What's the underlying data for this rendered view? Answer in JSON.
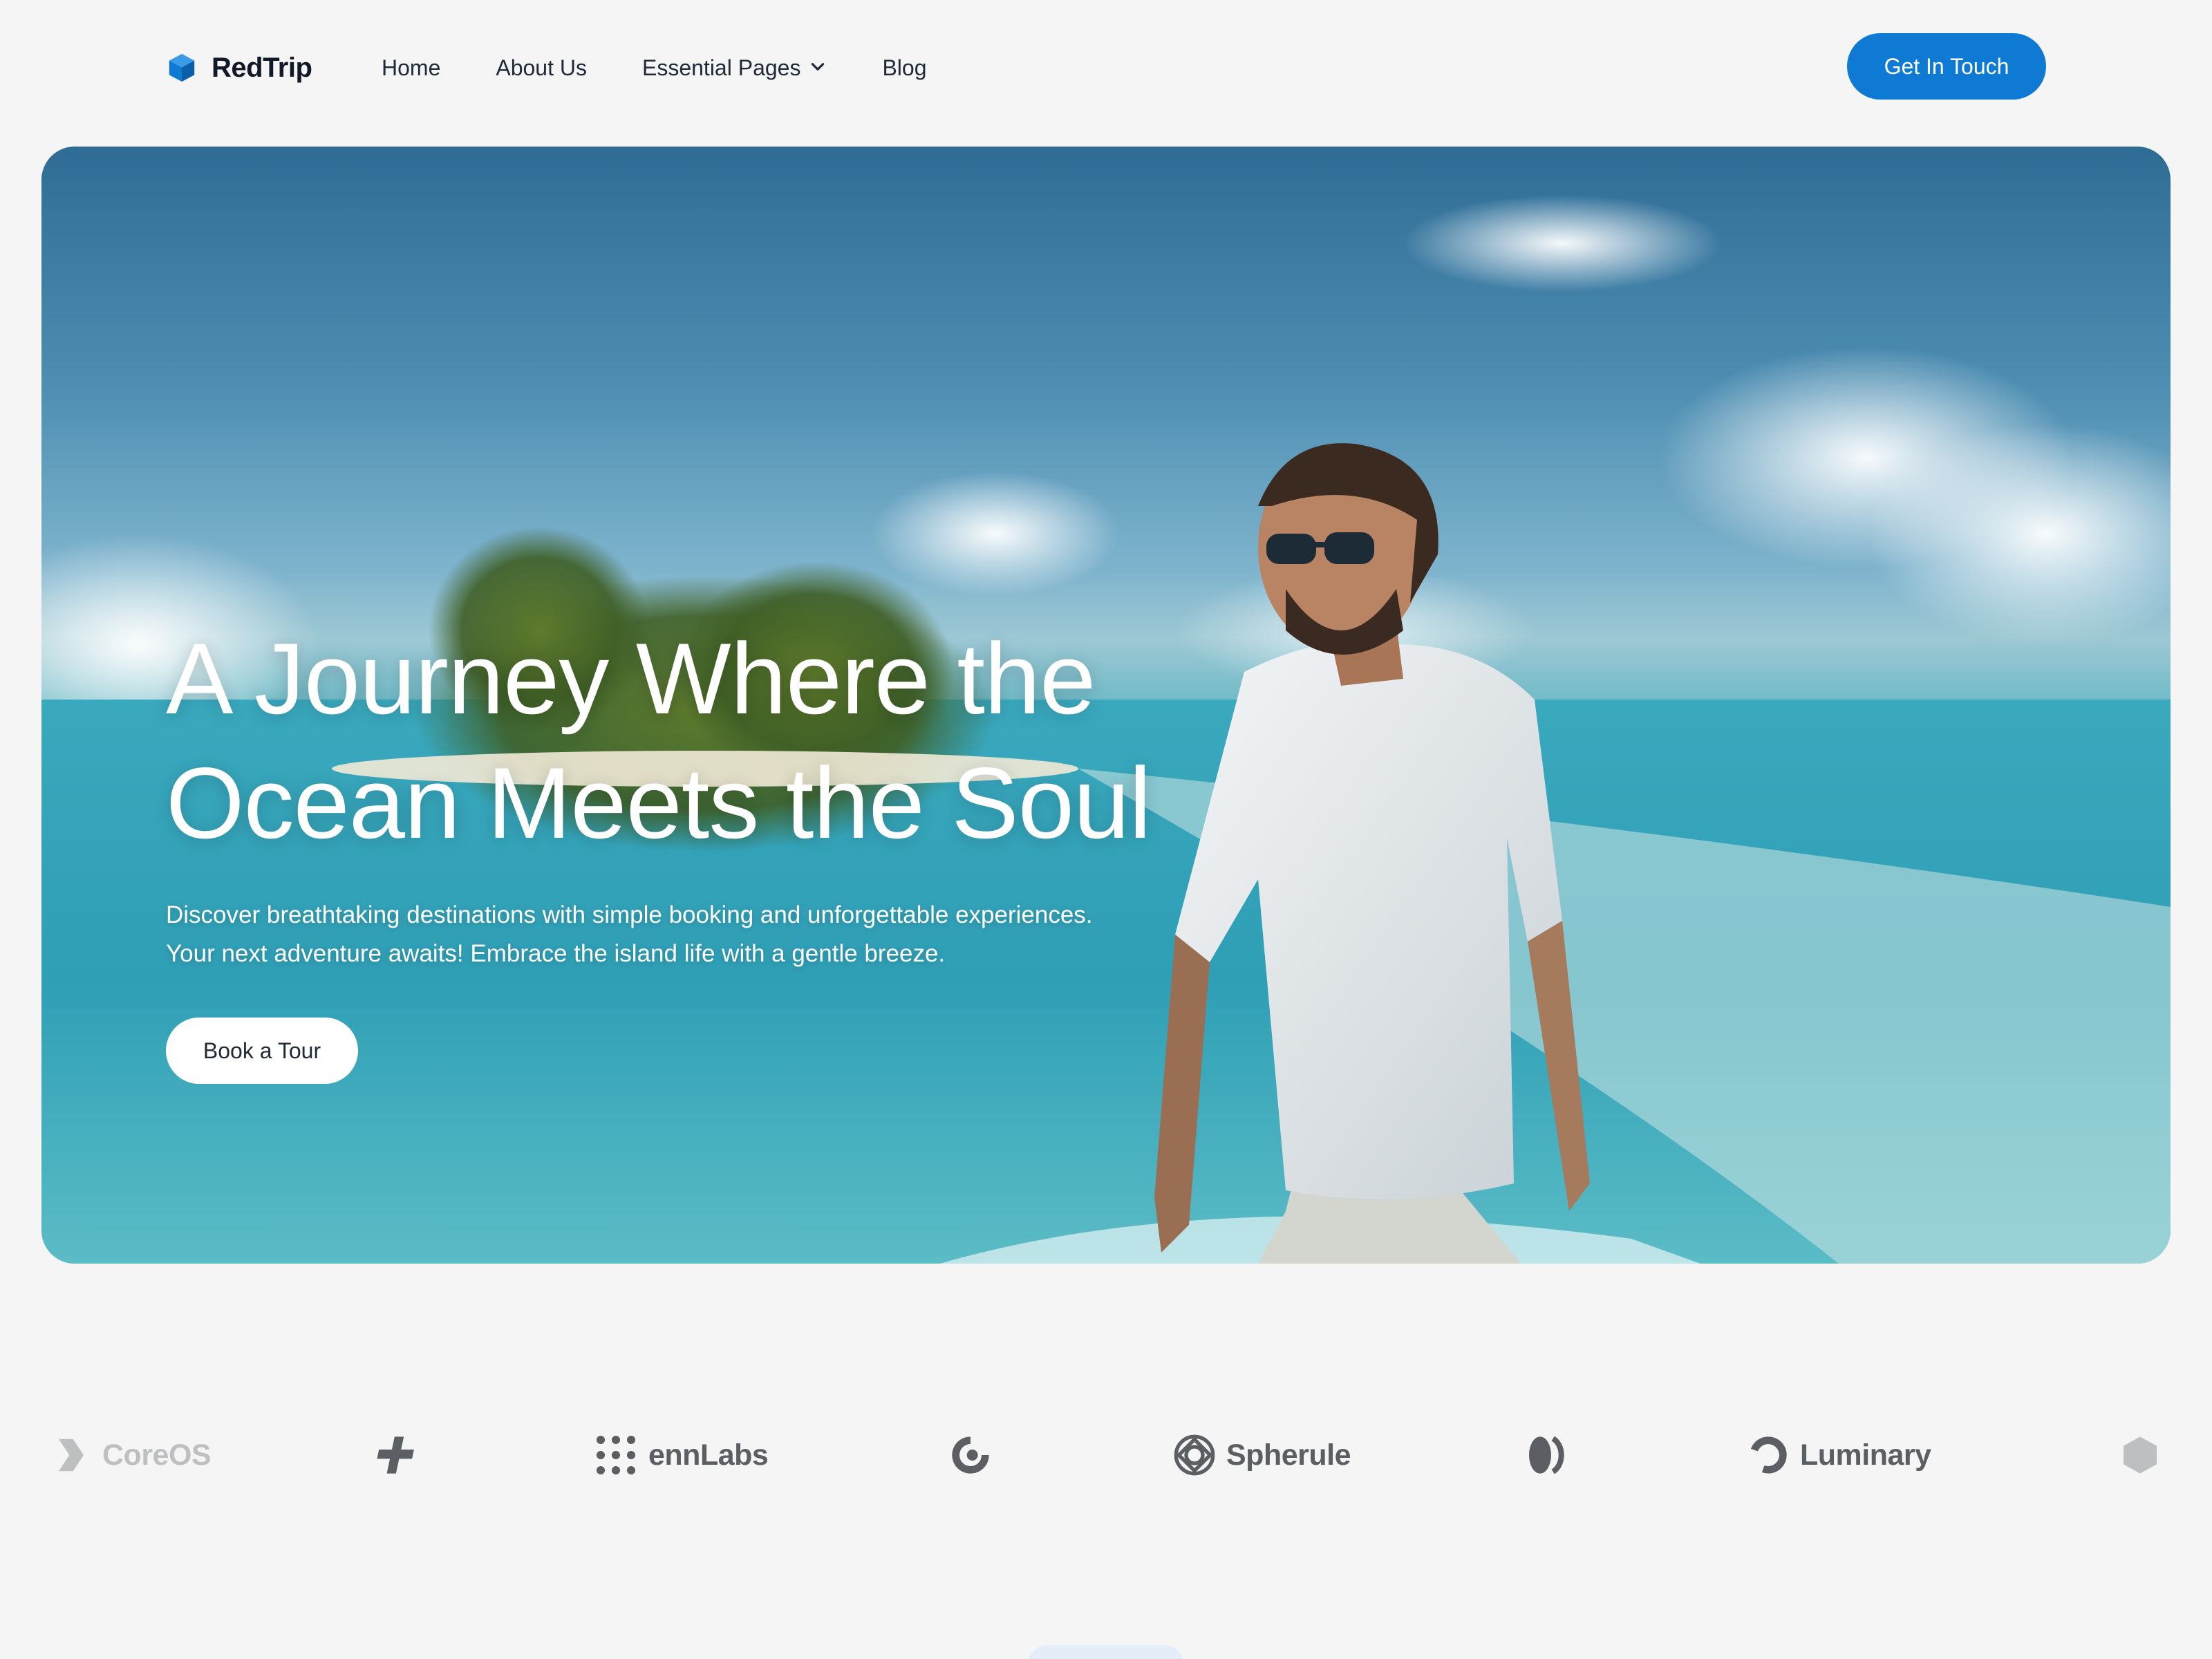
{
  "nav": {
    "brand": "RedTrip",
    "items": [
      {
        "label": "Home"
      },
      {
        "label": "About Us"
      },
      {
        "label": "Essential Pages",
        "has_dropdown": true
      },
      {
        "label": "Blog"
      }
    ],
    "cta_label": "Get In Touch"
  },
  "hero": {
    "title_line1": "A Journey Where the",
    "title_line2": "Ocean Meets the Soul",
    "desc_line1": "Discover breathtaking destinations with simple booking and unforgettable experiences.",
    "desc_line2": "Your next adventure awaits! Embrace the island life with a gentle breeze.",
    "button_label": "Book a Tour"
  },
  "logos": [
    {
      "name": "CoreOS"
    },
    {
      "name": ""
    },
    {
      "name": "ennLabs"
    },
    {
      "name": ""
    },
    {
      "name": "Spherule"
    },
    {
      "name": ""
    },
    {
      "name": "Luminary"
    },
    {
      "name": ""
    }
  ],
  "colors": {
    "accent": "#0e7ad4",
    "page_bg": "#f5f5f5",
    "logo_gray": "#5b5e63"
  }
}
